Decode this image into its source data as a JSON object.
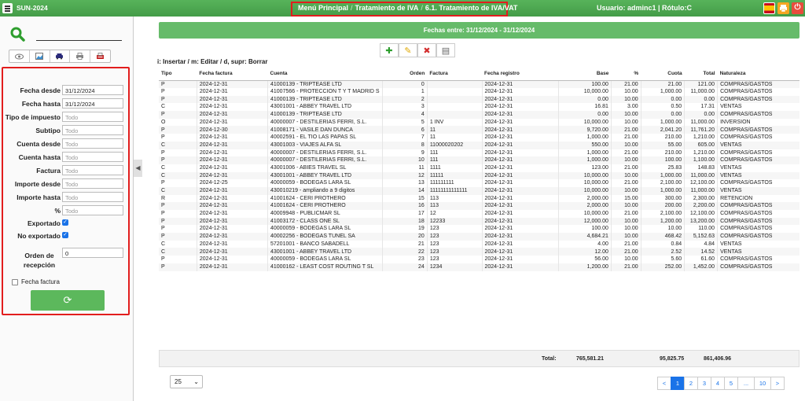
{
  "topbar": {
    "app_title": "SUN-2024",
    "breadcrumb": [
      "Menú Principal",
      "Tratamiento de IVA",
      "6.1. Tratamiento de IVA/VAT"
    ],
    "breadcrumb_sep": "/",
    "user": "Usuario: adminc1 | Rótulo:C",
    "power_glyph": "⏻"
  },
  "sidebar": {
    "tool_icons": [
      "eye-icon",
      "image-icon",
      "car-icon",
      "printer-icon",
      "pdf-icon"
    ],
    "filters": [
      {
        "label": "Fecha desde",
        "value": "31/12/2024",
        "placeholder": ""
      },
      {
        "label": "Fecha hasta",
        "value": "31/12/2024",
        "placeholder": ""
      },
      {
        "label": "Tipo de impuesto",
        "value": "",
        "placeholder": "Todo"
      },
      {
        "label": "Subtipo",
        "value": "",
        "placeholder": "Todo"
      },
      {
        "label": "Cuenta desde",
        "value": "",
        "placeholder": "Todo"
      },
      {
        "label": "Cuenta hasta",
        "value": "",
        "placeholder": "Todo"
      },
      {
        "label": "Factura",
        "value": "",
        "placeholder": "Todo"
      },
      {
        "label": "Importe desde",
        "value": "",
        "placeholder": "Todo"
      },
      {
        "label": "Importe hasta",
        "value": "",
        "placeholder": "Todo"
      },
      {
        "label": "%",
        "value": "",
        "placeholder": "Todo"
      }
    ],
    "exportado_label": "Exportado",
    "exportado_checked": true,
    "no_exportado_label": "No exportado",
    "no_exportado_checked": true,
    "orden_label": "Orden de recepción",
    "orden_value": "0",
    "fecha_factura_label": "Fecha factura",
    "fecha_factura_checked": false,
    "refresh_glyph": "⟳"
  },
  "main": {
    "date_bar": "Fechas entre: 31/12/2024 - 31/12/2024",
    "actions": [
      {
        "name": "add-icon",
        "glyph": "✚",
        "color": "#2e9e2e"
      },
      {
        "name": "edit-icon",
        "glyph": "✎",
        "color": "#e0a800"
      },
      {
        "name": "delete-icon",
        "glyph": "✖",
        "color": "#d32f2f"
      },
      {
        "name": "export-icon",
        "glyph": "▤",
        "color": "#666"
      }
    ],
    "hint": "i: Insertar / m: Editar / d, supr: Borrar",
    "columns": [
      "Tipo",
      "Fecha factura",
      "Cuenta",
      "Orden",
      "Factura",
      "Fecha registro",
      "Base",
      "%",
      "Cuota",
      "Total",
      "Naturaleza"
    ],
    "rows": [
      [
        "P",
        "2024-12-31",
        "41000139 - TRIPTEASE LTD",
        "0",
        "",
        "2024-12-31",
        "100.00",
        "21.00",
        "21.00",
        "121.00",
        "COMPRAS/GASTOS"
      ],
      [
        "P",
        "2024-12-31",
        "41007566 - PROTECCION T Y T MADRID S",
        "1",
        "",
        "2024-12-31",
        "10,000.00",
        "10.00",
        "1,000.00",
        "11,000.00",
        "COMPRAS/GASTOS"
      ],
      [
        "P",
        "2024-12-31",
        "41000139 - TRIPTEASE LTD",
        "2",
        "",
        "2024-12-31",
        "0.00",
        "10.00",
        "0.00",
        "0.00",
        "COMPRAS/GASTOS"
      ],
      [
        "C",
        "2024-12-31",
        "43001001 - ABBEY TRAVEL LTD",
        "3",
        "",
        "2024-12-31",
        "16.81",
        "3.00",
        "0.50",
        "17.31",
        "VENTAS"
      ],
      [
        "P",
        "2024-12-31",
        "41000139 - TRIPTEASE LTD",
        "4",
        "",
        "2024-12-31",
        "0.00",
        "10.00",
        "0.00",
        "0.00",
        "COMPRAS/GASTOS"
      ],
      [
        "O",
        "2024-12-31",
        "40000007 - DESTILERIAS FERRI, S.L.",
        "5",
        "1 INV",
        "2024-12-31",
        "10,000.00",
        "10.00",
        "1,000.00",
        "11,000.00",
        "INVERSION"
      ],
      [
        "P",
        "2024-12-30",
        "41008171 - VASILE DAN DUNCA",
        "6",
        "11",
        "2024-12-31",
        "9,720.00",
        "21.00",
        "2,041.20",
        "11,761.20",
        "COMPRAS/GASTOS"
      ],
      [
        "P",
        "2024-12-31",
        "40002591 - EL TIO LAS PAPAS SL",
        "7",
        "11",
        "2024-12-31",
        "1,000.00",
        "21.00",
        "210.00",
        "1,210.00",
        "COMPRAS/GASTOS"
      ],
      [
        "C",
        "2024-12-31",
        "43001003 - VIAJES ALFA SL",
        "8",
        "11000020202",
        "2024-12-31",
        "550.00",
        "10.00",
        "55.00",
        "605.00",
        "VENTAS"
      ],
      [
        "P",
        "2024-12-31",
        "40000007 - DESTILERIAS FERRI, S.L.",
        "9",
        "111",
        "2024-12-31",
        "1,000.00",
        "21.00",
        "210.00",
        "1,210.00",
        "COMPRAS/GASTOS"
      ],
      [
        "P",
        "2024-12-31",
        "40000007 - DESTILERIAS FERRI, S.L.",
        "10",
        "111",
        "2024-12-31",
        "1,000.00",
        "10.00",
        "100.00",
        "1,100.00",
        "COMPRAS/GASTOS"
      ],
      [
        "C",
        "2024-12-31",
        "43001006 - ABIES TRAVEL SL",
        "11",
        "1111",
        "2024-12-31",
        "123.00",
        "21.00",
        "25.83",
        "148.83",
        "VENTAS"
      ],
      [
        "C",
        "2024-12-31",
        "43001001 - ABBEY TRAVEL LTD",
        "12",
        "11111",
        "2024-12-31",
        "10,000.00",
        "10.00",
        "1,000.00",
        "11,000.00",
        "VENTAS"
      ],
      [
        "P",
        "2024-12-25",
        "40000059 - BODEGAS LARA SL",
        "13",
        "111111111",
        "2024-12-31",
        "10,000.00",
        "21.00",
        "2,100.00",
        "12,100.00",
        "COMPRAS/GASTOS"
      ],
      [
        "C",
        "2024-12-31",
        "430010219 - ampliando a 9 digitos",
        "14",
        "11111111111111",
        "2024-12-31",
        "10,000.00",
        "10.00",
        "1,000.00",
        "11,000.00",
        "VENTAS"
      ],
      [
        "R",
        "2024-12-31",
        "41001624 - CERI PROTHERO",
        "15",
        "113",
        "2024-12-31",
        "2,000.00",
        "15.00",
        "300.00",
        "2,300.00",
        "RETENCION"
      ],
      [
        "P",
        "2024-12-31",
        "41001624 - CERI PROTHERO",
        "16",
        "113",
        "2024-12-31",
        "2,000.00",
        "10.00",
        "200.00",
        "2,200.00",
        "COMPRAS/GASTOS"
      ],
      [
        "P",
        "2024-12-31",
        "40009948 - PUBLICMAR SL",
        "17",
        "12",
        "2024-12-31",
        "10,000.00",
        "21.00",
        "2,100.00",
        "12,100.00",
        "COMPRAS/GASTOS"
      ],
      [
        "P",
        "2024-12-31",
        "41003172 - CLASS ONE SL",
        "18",
        "12233",
        "2024-12-31",
        "12,000.00",
        "10.00",
        "1,200.00",
        "13,200.00",
        "COMPRAS/GASTOS"
      ],
      [
        "P",
        "2024-12-31",
        "40000059 - BODEGAS LARA SL",
        "19",
        "123",
        "2024-12-31",
        "100.00",
        "10.00",
        "10.00",
        "110.00",
        "COMPRAS/GASTOS"
      ],
      [
        "P",
        "2024-12-31",
        "40002256 - BODEGAS TUNEL SA",
        "20",
        "123",
        "2024-12-31",
        "4,684.21",
        "10.00",
        "468.42",
        "5,152.63",
        "COMPRAS/GASTOS"
      ],
      [
        "C",
        "2024-12-31",
        "57201001 - BANCO SABADELL",
        "21",
        "123",
        "2024-12-31",
        "4.00",
        "21.00",
        "0.84",
        "4.84",
        "VENTAS"
      ],
      [
        "C",
        "2024-12-31",
        "43001001 - ABBEY TRAVEL LTD",
        "22",
        "123",
        "2024-12-31",
        "12.00",
        "21.00",
        "2.52",
        "14.52",
        "VENTAS"
      ],
      [
        "P",
        "2024-12-31",
        "40000059 - BODEGAS LARA SL",
        "23",
        "123",
        "2024-12-31",
        "56.00",
        "10.00",
        "5.60",
        "61.60",
        "COMPRAS/GASTOS"
      ],
      [
        "P",
        "2024-12-31",
        "41000162 - LEAST COST ROUTING T SL",
        "24",
        "1234",
        "2024-12-31",
        "1,200.00",
        "21.00",
        "252.00",
        "1,452.00",
        "COMPRAS/GASTOS"
      ]
    ],
    "totals": {
      "label": "Total:",
      "base": "765,581.21",
      "cuota": "95,825.75",
      "total": "861,406.96"
    },
    "page_size": "25",
    "pager": [
      "<",
      "1",
      "2",
      "3",
      "4",
      "5",
      "...",
      "10",
      ">"
    ],
    "active_page": "1"
  }
}
